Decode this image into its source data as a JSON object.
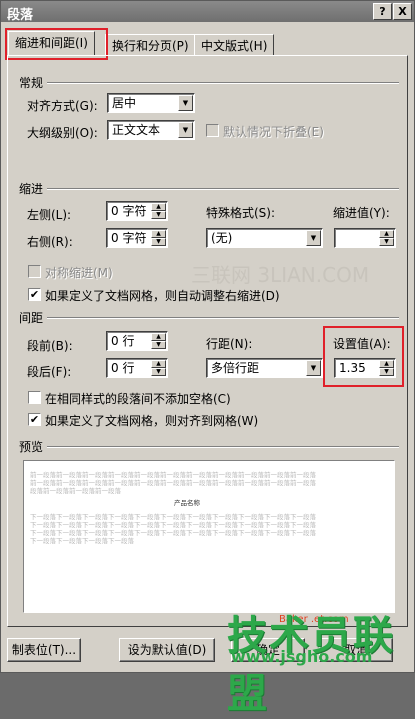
{
  "window": {
    "title": "段落",
    "help_btn": "?",
    "close_btn": "X"
  },
  "tabs": [
    {
      "label": "缩进和间距(I)",
      "active": true
    },
    {
      "label": "换行和分页(P)",
      "active": false
    },
    {
      "label": "中文版式(H)",
      "active": false
    }
  ],
  "general": {
    "title": "常规",
    "alignment_label": "对齐方式(G):",
    "alignment_value": "居中",
    "outline_label": "大纲级别(O):",
    "outline_value": "正文文本",
    "collapse_label": "默认情况下折叠(E)"
  },
  "indent": {
    "title": "缩进",
    "left_label": "左侧(L):",
    "left_value": "0 字符",
    "right_label": "右侧(R):",
    "right_value": "0 字符",
    "special_label": "特殊格式(S):",
    "special_value": "(无)",
    "by_label": "缩进值(Y):",
    "by_value": "",
    "mirror_label": "对称缩进(M)",
    "auto_right_label": "如果定义了文档网格，则自动调整右缩进(D)",
    "auto_right_checked": true
  },
  "spacing": {
    "title": "间距",
    "before_label": "段前(B):",
    "before_value": "0 行",
    "after_label": "段后(F):",
    "after_value": "0 行",
    "line_label": "行距(N):",
    "line_value": "多倍行距",
    "at_label": "设置值(A):",
    "at_value": "1.35",
    "no_space_label": "在相同样式的段落间不添加空格(C)",
    "no_space_checked": false,
    "snap_grid_label": "如果定义了文档网格，则对齐到网格(W)",
    "snap_grid_checked": true
  },
  "preview": {
    "title": "预览",
    "prev_lines": [
      "前一段落前一段落前一段落前一段落前一段落前一段落前一段落前一段落前一段落前一段落前一段落",
      "前一段落前一段落前一段落前一段落前一段落前一段落前一段落前一段落前一段落前一段落前一段落",
      "段落前一段落前一段落前一段落"
    ],
    "sample_text": "产品名称",
    "next_lines": [
      "下一段落下一段落下一段落下一段落下一段落下一段落下一段落下一段落下一段落下一段落下一段落",
      "下一段落下一段落下一段落下一段落下一段落下一段落下一段落下一段落下一段落下一段落下一段落",
      "下一段落下一段落下一段落下一段落下一段落下一段落下一段落下一段落下一段落下一段落下一段落",
      "下一段落下一段落下一段落下一段落"
    ]
  },
  "buttons": {
    "tabs_btn": "制表位(T)...",
    "default_btn": "设为默认值(D)",
    "ok_btn": "确定",
    "cancel_btn": "取消"
  },
  "watermarks": {
    "center": "三联网 3LIAN.COM",
    "logo": "技术员联盟",
    "logo_url": "www.jsgho.com",
    "small": "Baker .et.com"
  },
  "colors": {
    "highlight": "#e0202a",
    "logo_green": "#2da84a"
  }
}
